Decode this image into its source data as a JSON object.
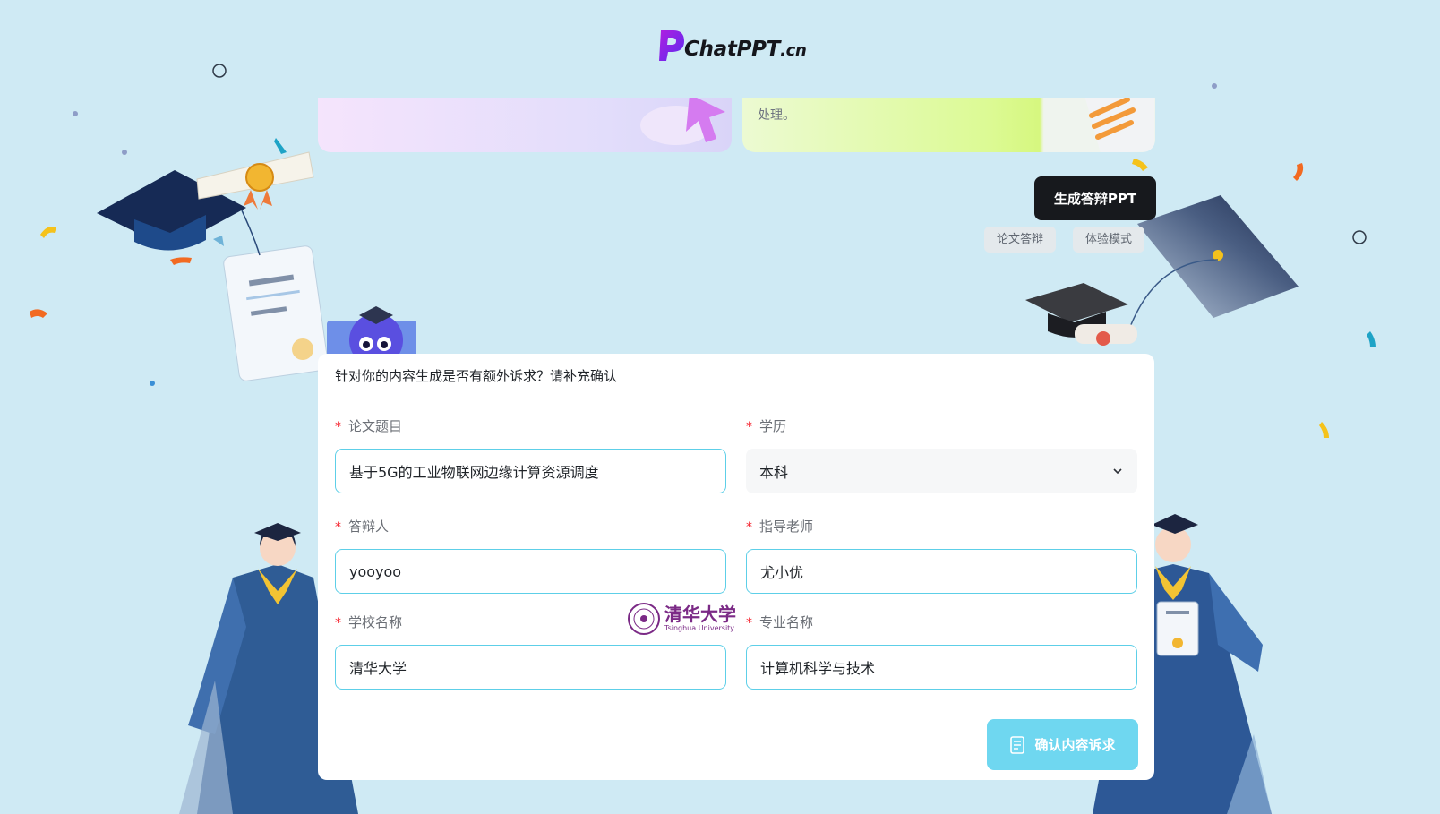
{
  "logo": {
    "text": "ChatPPT",
    "tld": ".cn"
  },
  "cards": {
    "left_text": "",
    "right_text": "处理。"
  },
  "header": {
    "generate_label": "生成答辩PPT",
    "tags": [
      "论文答辩",
      "体验模式"
    ]
  },
  "form": {
    "question": "针对你的内容生成是否有额外诉求？请补充确认",
    "required_mark": "*",
    "fields": {
      "thesis_title": {
        "label": "论文题目",
        "value": "基于5G的工业物联网边缘计算资源调度"
      },
      "degree": {
        "label": "学历",
        "value": "本科"
      },
      "defender": {
        "label": "答辩人",
        "value": "yooyoo"
      },
      "advisor": {
        "label": "指导老师",
        "value": "尤小优"
      },
      "school": {
        "label": "学校名称",
        "value": "清华大学"
      },
      "major": {
        "label": "专业名称",
        "value": "计算机科学与技术"
      }
    },
    "school_logo": {
      "cn": "清华大学",
      "en": "Tsinghua University"
    },
    "confirm_label": "确认内容诉求"
  },
  "colors": {
    "background": "#cfeaf4",
    "accent": "#5dcfe8",
    "confirm_button": "#6fd7f0",
    "generate_button": "#17191d",
    "required": "#f5222d",
    "brand_purple": "#8a2be2"
  },
  "icons": {
    "logo": "chatppt-logo-icon",
    "select": "chevron-down-icon",
    "confirm": "document-icon"
  }
}
